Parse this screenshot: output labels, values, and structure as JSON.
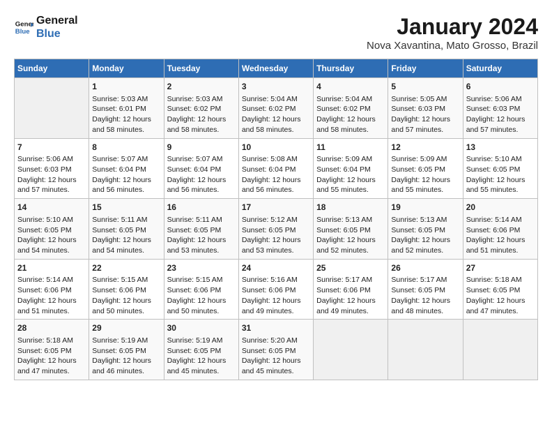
{
  "header": {
    "logo_line1": "General",
    "logo_line2": "Blue",
    "month_year": "January 2024",
    "location": "Nova Xavantina, Mato Grosso, Brazil"
  },
  "days_of_week": [
    "Sunday",
    "Monday",
    "Tuesday",
    "Wednesday",
    "Thursday",
    "Friday",
    "Saturday"
  ],
  "weeks": [
    [
      {
        "day": "",
        "info": ""
      },
      {
        "day": "1",
        "info": "Sunrise: 5:03 AM\nSunset: 6:01 PM\nDaylight: 12 hours\nand 58 minutes."
      },
      {
        "day": "2",
        "info": "Sunrise: 5:03 AM\nSunset: 6:02 PM\nDaylight: 12 hours\nand 58 minutes."
      },
      {
        "day": "3",
        "info": "Sunrise: 5:04 AM\nSunset: 6:02 PM\nDaylight: 12 hours\nand 58 minutes."
      },
      {
        "day": "4",
        "info": "Sunrise: 5:04 AM\nSunset: 6:02 PM\nDaylight: 12 hours\nand 58 minutes."
      },
      {
        "day": "5",
        "info": "Sunrise: 5:05 AM\nSunset: 6:03 PM\nDaylight: 12 hours\nand 57 minutes."
      },
      {
        "day": "6",
        "info": "Sunrise: 5:06 AM\nSunset: 6:03 PM\nDaylight: 12 hours\nand 57 minutes."
      }
    ],
    [
      {
        "day": "7",
        "info": "Sunrise: 5:06 AM\nSunset: 6:03 PM\nDaylight: 12 hours\nand 57 minutes."
      },
      {
        "day": "8",
        "info": "Sunrise: 5:07 AM\nSunset: 6:04 PM\nDaylight: 12 hours\nand 56 minutes."
      },
      {
        "day": "9",
        "info": "Sunrise: 5:07 AM\nSunset: 6:04 PM\nDaylight: 12 hours\nand 56 minutes."
      },
      {
        "day": "10",
        "info": "Sunrise: 5:08 AM\nSunset: 6:04 PM\nDaylight: 12 hours\nand 56 minutes."
      },
      {
        "day": "11",
        "info": "Sunrise: 5:09 AM\nSunset: 6:04 PM\nDaylight: 12 hours\nand 55 minutes."
      },
      {
        "day": "12",
        "info": "Sunrise: 5:09 AM\nSunset: 6:05 PM\nDaylight: 12 hours\nand 55 minutes."
      },
      {
        "day": "13",
        "info": "Sunrise: 5:10 AM\nSunset: 6:05 PM\nDaylight: 12 hours\nand 55 minutes."
      }
    ],
    [
      {
        "day": "14",
        "info": "Sunrise: 5:10 AM\nSunset: 6:05 PM\nDaylight: 12 hours\nand 54 minutes."
      },
      {
        "day": "15",
        "info": "Sunrise: 5:11 AM\nSunset: 6:05 PM\nDaylight: 12 hours\nand 54 minutes."
      },
      {
        "day": "16",
        "info": "Sunrise: 5:11 AM\nSunset: 6:05 PM\nDaylight: 12 hours\nand 53 minutes."
      },
      {
        "day": "17",
        "info": "Sunrise: 5:12 AM\nSunset: 6:05 PM\nDaylight: 12 hours\nand 53 minutes."
      },
      {
        "day": "18",
        "info": "Sunrise: 5:13 AM\nSunset: 6:05 PM\nDaylight: 12 hours\nand 52 minutes."
      },
      {
        "day": "19",
        "info": "Sunrise: 5:13 AM\nSunset: 6:05 PM\nDaylight: 12 hours\nand 52 minutes."
      },
      {
        "day": "20",
        "info": "Sunrise: 5:14 AM\nSunset: 6:06 PM\nDaylight: 12 hours\nand 51 minutes."
      }
    ],
    [
      {
        "day": "21",
        "info": "Sunrise: 5:14 AM\nSunset: 6:06 PM\nDaylight: 12 hours\nand 51 minutes."
      },
      {
        "day": "22",
        "info": "Sunrise: 5:15 AM\nSunset: 6:06 PM\nDaylight: 12 hours\nand 50 minutes."
      },
      {
        "day": "23",
        "info": "Sunrise: 5:15 AM\nSunset: 6:06 PM\nDaylight: 12 hours\nand 50 minutes."
      },
      {
        "day": "24",
        "info": "Sunrise: 5:16 AM\nSunset: 6:06 PM\nDaylight: 12 hours\nand 49 minutes."
      },
      {
        "day": "25",
        "info": "Sunrise: 5:17 AM\nSunset: 6:06 PM\nDaylight: 12 hours\nand 49 minutes."
      },
      {
        "day": "26",
        "info": "Sunrise: 5:17 AM\nSunset: 6:05 PM\nDaylight: 12 hours\nand 48 minutes."
      },
      {
        "day": "27",
        "info": "Sunrise: 5:18 AM\nSunset: 6:05 PM\nDaylight: 12 hours\nand 47 minutes."
      }
    ],
    [
      {
        "day": "28",
        "info": "Sunrise: 5:18 AM\nSunset: 6:05 PM\nDaylight: 12 hours\nand 47 minutes."
      },
      {
        "day": "29",
        "info": "Sunrise: 5:19 AM\nSunset: 6:05 PM\nDaylight: 12 hours\nand 46 minutes."
      },
      {
        "day": "30",
        "info": "Sunrise: 5:19 AM\nSunset: 6:05 PM\nDaylight: 12 hours\nand 45 minutes."
      },
      {
        "day": "31",
        "info": "Sunrise: 5:20 AM\nSunset: 6:05 PM\nDaylight: 12 hours\nand 45 minutes."
      },
      {
        "day": "",
        "info": ""
      },
      {
        "day": "",
        "info": ""
      },
      {
        "day": "",
        "info": ""
      }
    ]
  ]
}
